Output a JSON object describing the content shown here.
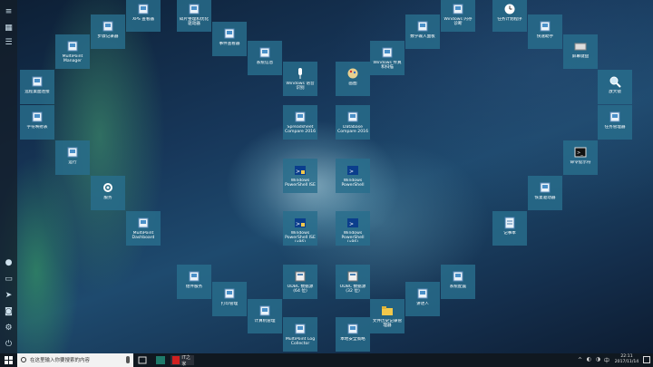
{
  "tiles": [
    {
      "key": "xps",
      "label": "XPS 查看器",
      "icon": "xps-viewer-icon"
    },
    {
      "key": "defrag",
      "label": "碎片整理和优化驱动器",
      "icon": "defrag-icon"
    },
    {
      "key": "steps",
      "label": "步骤记录器",
      "icon": "steps-recorder-icon"
    },
    {
      "key": "multipoint-manager",
      "label": "MultiPoint Manager",
      "icon": "multipoint-manager-icon"
    },
    {
      "key": "event-viewer",
      "label": "事件查看器",
      "icon": "event-viewer-icon"
    },
    {
      "key": "sysinfo",
      "label": "系统信息",
      "icon": "system-info-icon"
    },
    {
      "key": "voice",
      "label": "Windows 语音识别",
      "icon": "microphone-icon"
    },
    {
      "key": "paint",
      "label": "画图",
      "icon": "paint-icon"
    },
    {
      "key": "fax",
      "label": "Windows 传真和扫描",
      "icon": "fax-scan-icon"
    },
    {
      "key": "math",
      "label": "数学输入面板",
      "icon": "math-input-icon"
    },
    {
      "key": "media",
      "label": "Windows 内存诊断",
      "icon": "memory-diagnostic-icon"
    },
    {
      "key": "task-scheduler",
      "label": "任务计划程序",
      "icon": "clock-icon"
    },
    {
      "key": "quick-assist",
      "label": "快速助手",
      "icon": "quick-assist-icon"
    },
    {
      "key": "remote",
      "label": "远程桌面连接",
      "icon": "remote-desktop-icon"
    },
    {
      "key": "charmap",
      "label": "字符映射表",
      "icon": "charmap-icon"
    },
    {
      "key": "spreadsheet",
      "label": "Spreadsheet Compare 2016",
      "icon": "spreadsheet-compare-icon"
    },
    {
      "key": "database",
      "label": "Database Compare 2016",
      "icon": "database-compare-icon"
    },
    {
      "key": "screen-kbd",
      "label": "屏幕键盘",
      "icon": "keyboard-icon"
    },
    {
      "key": "magnifier",
      "label": "放大镜",
      "icon": "magnifier-icon"
    },
    {
      "key": "task-manager",
      "label": "任务管理器",
      "icon": "task-manager-icon"
    },
    {
      "key": "run",
      "label": "运行",
      "icon": "run-icon"
    },
    {
      "key": "cmd",
      "label": "命令提示符",
      "icon": "cmd-icon"
    },
    {
      "key": "services",
      "label": "服务",
      "icon": "gear-icon"
    },
    {
      "key": "ps-ise",
      "label": "Windows PowerShell ISE",
      "icon": "powershell-ise-icon"
    },
    {
      "key": "ps",
      "label": "Windows PowerShell",
      "icon": "powershell-icon"
    },
    {
      "key": "recovery",
      "label": "恢复驱动器",
      "icon": "recovery-drive-icon"
    },
    {
      "key": "multipoint-dashboard",
      "label": "MultiPoint Dashboard",
      "icon": "dashboard-icon"
    },
    {
      "key": "ps-ise86",
      "label": "Windows PowerShell ISE (x86)",
      "icon": "powershell-ise-icon"
    },
    {
      "key": "ps86",
      "label": "Windows PowerShell (x86)",
      "icon": "powershell-icon"
    },
    {
      "key": "notepad",
      "label": "记事本",
      "icon": "notepad-icon"
    },
    {
      "key": "components",
      "label": "组件服务",
      "icon": "component-services-icon"
    },
    {
      "key": "sysconfig",
      "label": "系统配置",
      "icon": "system-config-icon"
    },
    {
      "key": "print",
      "label": "打印管理",
      "icon": "print-management-icon"
    },
    {
      "key": "odbc64",
      "label": "ODBC 数据源(64 位)",
      "icon": "odbc-icon"
    },
    {
      "key": "odbc32",
      "label": "ODBC 数据源(32 位)",
      "icon": "odbc-icon"
    },
    {
      "key": "narrator",
      "label": "讲述人",
      "icon": "narrator-icon"
    },
    {
      "key": "computer-mgmt",
      "label": "计算机管理",
      "icon": "computer-management-icon"
    },
    {
      "key": "multipoint-log",
      "label": "MultiPoint Log Collector",
      "icon": "log-collector-icon"
    },
    {
      "key": "local-security",
      "label": "本地安全策略",
      "icon": "security-policy-icon"
    },
    {
      "key": "file-history",
      "label": "文件历史记录管理器",
      "icon": "folder-icon"
    }
  ],
  "taskbar": {
    "search_placeholder": "在这里输入你要搜索的内容",
    "app_label": "IT之家",
    "time": "22:11",
    "date": "2017/11/14"
  },
  "colors": {
    "tile": "#2a7aa0",
    "taskbar": "#101820",
    "search": "#f2f2f2"
  }
}
